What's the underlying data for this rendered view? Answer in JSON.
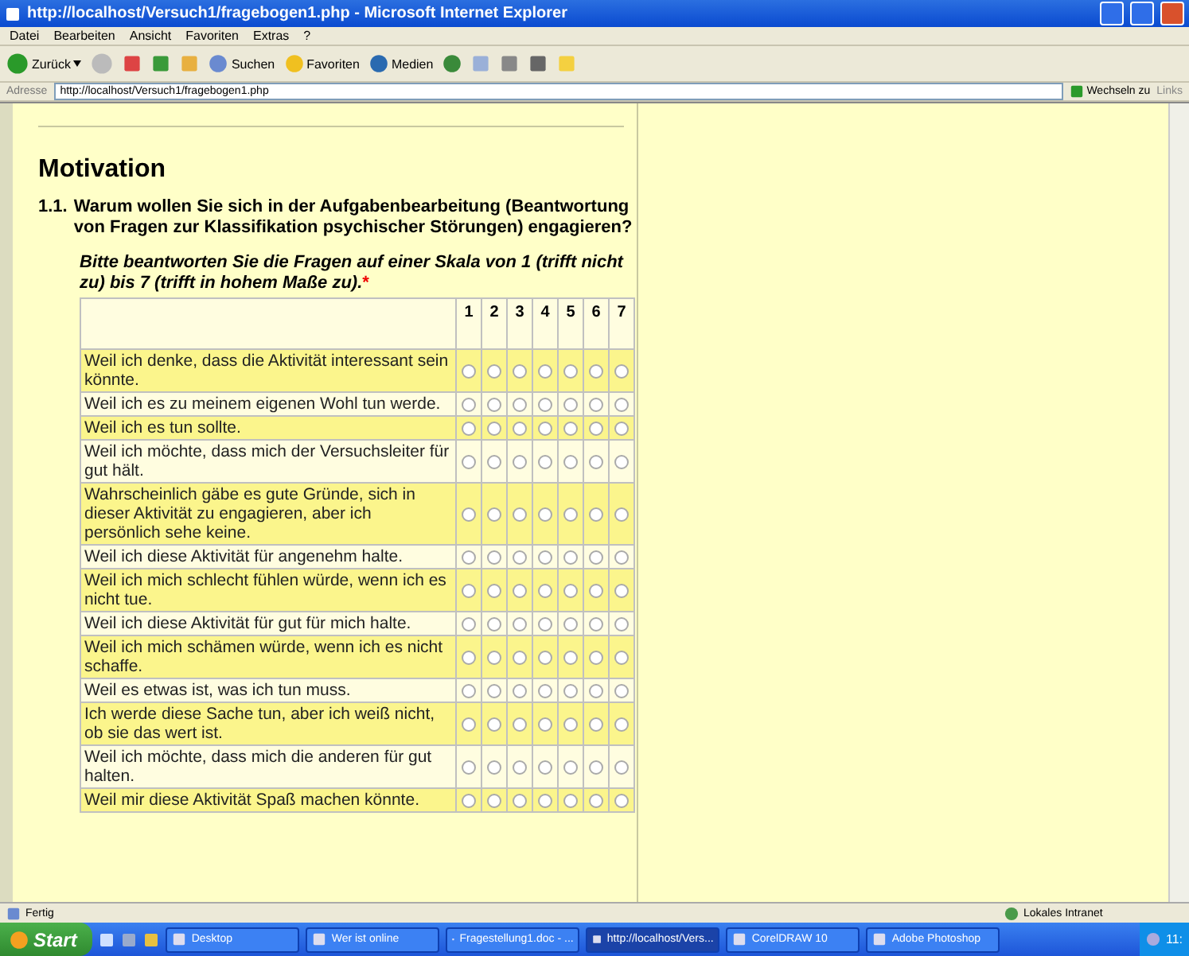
{
  "window": {
    "title": "http://localhost/Versuch1/fragebogen1.php - Microsoft Internet Explorer"
  },
  "menu": [
    "Datei",
    "Bearbeiten",
    "Ansicht",
    "Favoriten",
    "Extras",
    "?"
  ],
  "toolbar": {
    "back": "Zurück",
    "search": "Suchen",
    "favorites": "Favoriten",
    "media": "Medien"
  },
  "address_bar": {
    "label": "Adresse",
    "value": "http://localhost/Versuch1/fragebogen1.php",
    "go": "Wechseln zu",
    "links": "Links"
  },
  "page": {
    "heading": "Motivation",
    "question_number": "1.1.",
    "question": "Warum wollen Sie sich in der Aufgabenbearbeitung (Beantwortung von Fragen zur Klassifikation psychischer Störungen) engagieren?",
    "instruction": "Bitte beantworten Sie die Fragen auf einer Skala von 1 (trifft nicht zu) bis 7 (trifft in hohem Maße zu).",
    "required_mark": "*",
    "scale": [
      "1",
      "2",
      "3",
      "4",
      "5",
      "6",
      "7"
    ],
    "rows": [
      {
        "text": "Weil ich denke, dass die Aktivität interessant sein könnte.",
        "selected": [
          false,
          false,
          false,
          false,
          false,
          false,
          false
        ]
      },
      {
        "text": "Weil ich es zu meinem eigenen Wohl tun werde.",
        "selected": [
          false,
          false,
          false,
          false,
          false,
          false,
          false
        ]
      },
      {
        "text": "Weil ich es tun sollte.",
        "selected": [
          false,
          false,
          false,
          false,
          false,
          false,
          false
        ]
      },
      {
        "text": "Weil ich möchte, dass mich der Versuchsleiter für gut hält.",
        "selected": [
          false,
          false,
          false,
          false,
          false,
          false,
          false
        ]
      },
      {
        "text": "Wahrscheinlich gäbe es gute Gründe, sich in dieser Aktivität zu engagieren, aber ich persönlich sehe keine.",
        "selected": [
          false,
          false,
          false,
          false,
          false,
          false,
          false
        ]
      },
      {
        "text": "Weil ich diese Aktivität für angenehm halte.",
        "selected": [
          false,
          false,
          false,
          false,
          false,
          false,
          false
        ]
      },
      {
        "text": "Weil ich mich schlecht fühlen würde, wenn ich es nicht tue.",
        "selected": [
          false,
          false,
          false,
          false,
          false,
          false,
          false
        ]
      },
      {
        "text": "Weil ich diese Aktivität für gut für mich halte.",
        "selected": [
          false,
          false,
          false,
          false,
          false,
          false,
          false
        ]
      },
      {
        "text": "Weil ich mich schämen würde, wenn ich es nicht schaffe.",
        "selected": [
          false,
          false,
          false,
          false,
          false,
          false,
          false
        ]
      },
      {
        "text": "Weil es etwas ist, was ich tun muss.",
        "selected": [
          false,
          false,
          false,
          false,
          false,
          false,
          false
        ]
      },
      {
        "text": "Ich werde diese Sache tun, aber ich weiß nicht, ob sie das wert ist.",
        "selected": [
          false,
          false,
          false,
          false,
          false,
          false,
          false
        ]
      },
      {
        "text": "Weil ich möchte, dass mich die anderen für gut halten.",
        "selected": [
          false,
          false,
          false,
          false,
          false,
          false,
          false
        ]
      },
      {
        "text": "Weil mir diese Aktivität Spaß machen könnte.",
        "selected": [
          false,
          false,
          false,
          false,
          false,
          false,
          false
        ]
      }
    ]
  },
  "status_bar": {
    "status": "Fertig",
    "zone": "Lokales Intranet"
  },
  "taskbar": {
    "start": "Start",
    "tasks": [
      {
        "label": "Desktop",
        "selected": false
      },
      {
        "label": "Wer ist online",
        "selected": false
      },
      {
        "label": "Fragestellung1.doc - ...",
        "selected": false
      },
      {
        "label": "http://localhost/Vers...",
        "selected": true
      },
      {
        "label": "CorelDRAW 10",
        "selected": false
      },
      {
        "label": "Adobe Photoshop",
        "selected": false
      }
    ],
    "clock": "11:"
  }
}
